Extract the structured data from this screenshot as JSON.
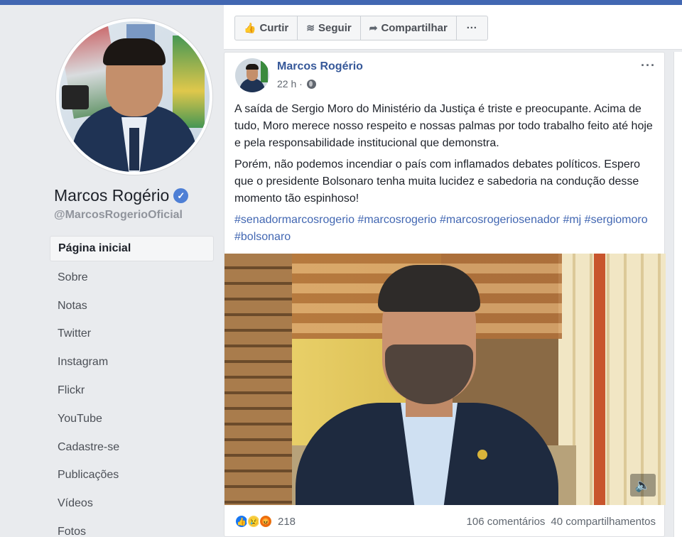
{
  "page": {
    "name": "Marcos Rogério",
    "handle": "@MarcosRogerioOficial",
    "verified": true
  },
  "nav": {
    "items": [
      {
        "label": "Página inicial",
        "active": true
      },
      {
        "label": "Sobre"
      },
      {
        "label": "Notas"
      },
      {
        "label": "Twitter"
      },
      {
        "label": "Instagram"
      },
      {
        "label": "Flickr"
      },
      {
        "label": "YouTube"
      },
      {
        "label": "Cadastre-se"
      },
      {
        "label": "Publicações"
      },
      {
        "label": "Vídeos"
      },
      {
        "label": "Fotos"
      }
    ]
  },
  "actions": {
    "like": "Curtir",
    "follow": "Seguir",
    "share": "Compartilhar",
    "more": "···"
  },
  "post": {
    "author": "Marcos Rogério",
    "time": "22 h ·",
    "more": "···",
    "paragraph1": "A saída de Sergio Moro do Ministério da Justiça é triste e preocupante. Acima de tudo, Moro merece nosso respeito e nossas palmas por todo trabalho feito até hoje e pela responsabilidade institucional que demonstra.",
    "paragraph2": "Porém, não podemos incendiar o país com inflamados debates políticos. Espero que o presidente Bolsonaro tenha muita lucidez e sabedoria na condução desse momento tão espinhoso!",
    "hashtags": "#senadormarcosrogerio #marcosrogerio #marcosrogeriosenador #mj #sergiomoro #bolsonaro",
    "reaction_count": "218",
    "comments": "106 comentários",
    "shares": "40 compartilhamentos"
  },
  "colors": {
    "brand": "#4267b2",
    "link": "#365899"
  },
  "icons": {
    "like": "thumbs-up-icon",
    "follow": "rss-icon",
    "share": "share-arrow-icon",
    "privacy": "globe-icon",
    "volume": "volume-icon"
  }
}
